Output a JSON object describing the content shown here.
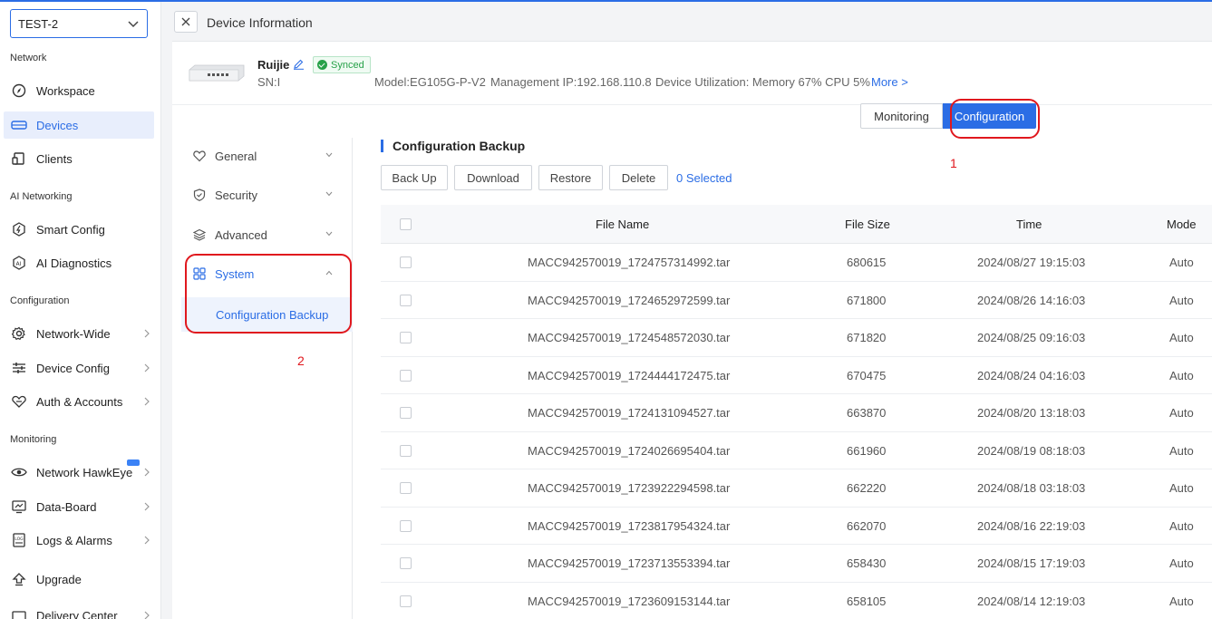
{
  "sidebar": {
    "project": "TEST-2",
    "sections": {
      "network": "Network",
      "ai_networking": "AI Networking",
      "configuration": "Configuration",
      "monitoring": "Monitoring"
    },
    "items": {
      "workspace": "Workspace",
      "devices": "Devices",
      "clients": "Clients",
      "smart_config": "Smart Config",
      "ai_diagnostics": "AI Diagnostics",
      "network_wide": "Network-Wide",
      "device_config": "Device Config",
      "auth_accounts": "Auth & Accounts",
      "network_hawkeye": "Network HawkEye",
      "data_board": "Data-Board",
      "logs_alarms": "Logs & Alarms",
      "upgrade": "Upgrade",
      "delivery_center": "Delivery Center"
    }
  },
  "header": {
    "title": "Device Information"
  },
  "device": {
    "name": "Ruijie",
    "status": "Synced",
    "sn": "SN:I",
    "model": "Model:EG105G-P-V2",
    "management_ip": "Management IP:192.168.110.8",
    "utilization": "Device Utilization: Memory 67% CPU 5%",
    "more": "More >"
  },
  "tabs": {
    "monitoring": "Monitoring",
    "configuration": "Configuration"
  },
  "annotations": {
    "one": "1",
    "two": "2"
  },
  "submenu": {
    "general": "General",
    "security": "Security",
    "advanced": "Advanced",
    "system": "System",
    "configuration_backup": "Configuration Backup"
  },
  "content": {
    "title": "Configuration Backup",
    "buttons": {
      "back_up": "Back Up",
      "download": "Download",
      "restore": "Restore",
      "delete": "Delete"
    },
    "selected": "0 Selected"
  },
  "table": {
    "columns": {
      "file_name": "File Name",
      "file_size": "File Size",
      "time": "Time",
      "mode": "Mode"
    },
    "rows": [
      {
        "file": "MACC942570019_1724757314992.tar",
        "size": "680615",
        "time": "2024/08/27 19:15:03",
        "mode": "Auto"
      },
      {
        "file": "MACC942570019_1724652972599.tar",
        "size": "671800",
        "time": "2024/08/26 14:16:03",
        "mode": "Auto"
      },
      {
        "file": "MACC942570019_1724548572030.tar",
        "size": "671820",
        "time": "2024/08/25 09:16:03",
        "mode": "Auto"
      },
      {
        "file": "MACC942570019_1724444172475.tar",
        "size": "670475",
        "time": "2024/08/24 04:16:03",
        "mode": "Auto"
      },
      {
        "file": "MACC942570019_1724131094527.tar",
        "size": "663870",
        "time": "2024/08/20 13:18:03",
        "mode": "Auto"
      },
      {
        "file": "MACC942570019_1724026695404.tar",
        "size": "661960",
        "time": "2024/08/19 08:18:03",
        "mode": "Auto"
      },
      {
        "file": "MACC942570019_1723922294598.tar",
        "size": "662220",
        "time": "2024/08/18 03:18:03",
        "mode": "Auto"
      },
      {
        "file": "MACC942570019_1723817954324.tar",
        "size": "662070",
        "time": "2024/08/16 22:19:03",
        "mode": "Auto"
      },
      {
        "file": "MACC942570019_1723713553394.tar",
        "size": "658430",
        "time": "2024/08/15 17:19:03",
        "mode": "Auto"
      },
      {
        "file": "MACC942570019_1723609153144.tar",
        "size": "658105",
        "time": "2024/08/14 12:19:03",
        "mode": "Auto"
      }
    ]
  },
  "colors": {
    "accent": "#2b6de5",
    "annotation_red": "#e0181e",
    "synced_green": "#27a149"
  }
}
